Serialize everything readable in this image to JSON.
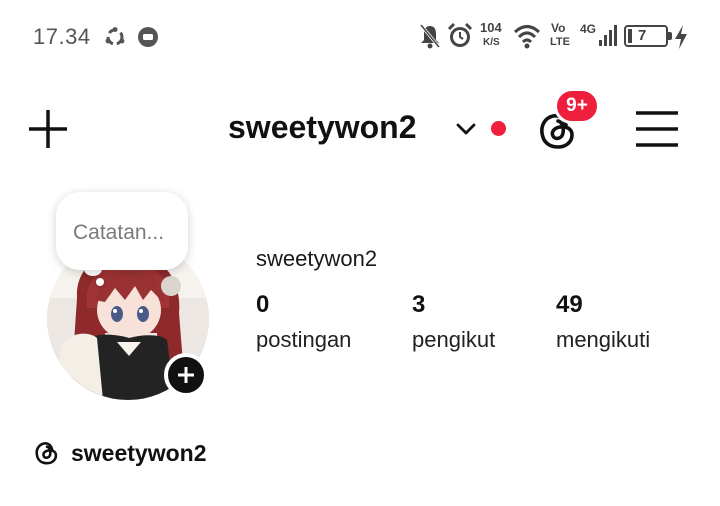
{
  "status_bar": {
    "time": "17.34",
    "network_speed_value": "104",
    "network_speed_unit": "K/S",
    "volte_top": "Vo",
    "volte_bottom": "LTE",
    "network_type": "4G",
    "battery_level": "7",
    "icons": [
      "sync-icon",
      "chat-app-icon",
      "mute-bell-icon",
      "alarm-icon",
      "wifi-icon",
      "signal-icon",
      "battery-icon",
      "charging-icon"
    ]
  },
  "header": {
    "username": "sweetywon2",
    "notification_badge": "9+",
    "icons": [
      "plus-icon",
      "chevron-down-icon",
      "threads-icon",
      "hamburger-menu-icon"
    ],
    "accent_color": "#ef1f3d"
  },
  "profile": {
    "note_placeholder": "Catatan...",
    "display_name": "sweetywon2",
    "stats": [
      {
        "value": "0",
        "label": "postingan"
      },
      {
        "value": "3",
        "label": "pengikut"
      },
      {
        "value": "49",
        "label": "mengikuti"
      }
    ],
    "threads_username": "sweetywon2"
  }
}
